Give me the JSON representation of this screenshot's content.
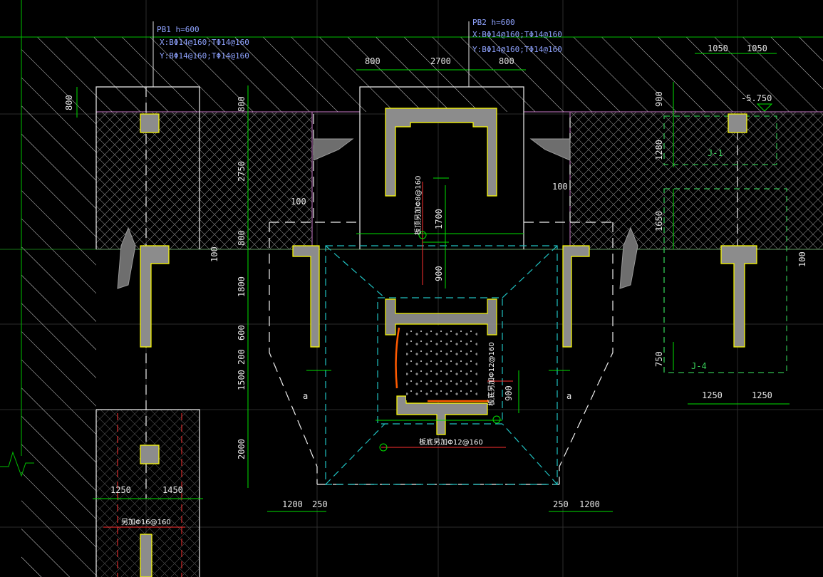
{
  "colors": {
    "background": "#000000",
    "grid": "#2d2d2d",
    "dimension": "#00e000",
    "outline": "#ffffff",
    "wall_fill": "#8c8c8c",
    "wall_edge": "#ffff00",
    "slab_edge": "#c87ac8",
    "pit_dash": "#20c0c0",
    "rebar_red": "#ff3030",
    "rebar_orange": "#ff5a00",
    "label_blue": "#8fa3ff"
  },
  "labels": {
    "pb1_title": "PB1 h=600",
    "pb1_x": "X:BΦ14@160;TΦ14@160",
    "pb1_y": "Y:BΦ14@160;TΦ14@160",
    "pb2_title": "PB2 h=600",
    "pb2_x": "X:BΦ14@160;TΦ14@160",
    "pb2_y": "Y:BΦ14@160;TΦ14@160",
    "elev": "-5.750",
    "j1": "J-1",
    "j4": "J-4",
    "section_a_left": "a",
    "section_a_right": "a",
    "rebar_center": "板顶另加Φ8@160",
    "rebar_bottom": "板底另加Φ12@160",
    "rebar_right": "板底另加Φ12@160",
    "rebar_left": "另加Φ16@160"
  },
  "dims": {
    "top_800a": "800",
    "top_2700": "2700",
    "top_800b": "800",
    "top_1050a": "1050",
    "top_1050b": "1050",
    "left_800": "800",
    "v_800a": "800",
    "v_2750": "2750",
    "v_800b": "800",
    "v_100a": "100",
    "v_1800": "1800",
    "v_600": "600",
    "v_200": "200",
    "v_1500": "1500",
    "v_2000": "2000",
    "h_100a": "100",
    "h_100b": "100",
    "c_1700": "1700",
    "c_900a": "900",
    "c_900b": "900",
    "r_900": "900",
    "r_1280": "1280",
    "r_1650": "1650",
    "r_750": "750",
    "r_100": "100",
    "r_1250a": "1250",
    "r_1250b": "1250",
    "bl_1250": "1250",
    "bl_1450": "1450",
    "b_1200a": "1200",
    "b_250a": "250",
    "b_250b": "250",
    "b_1200b": "1200"
  }
}
